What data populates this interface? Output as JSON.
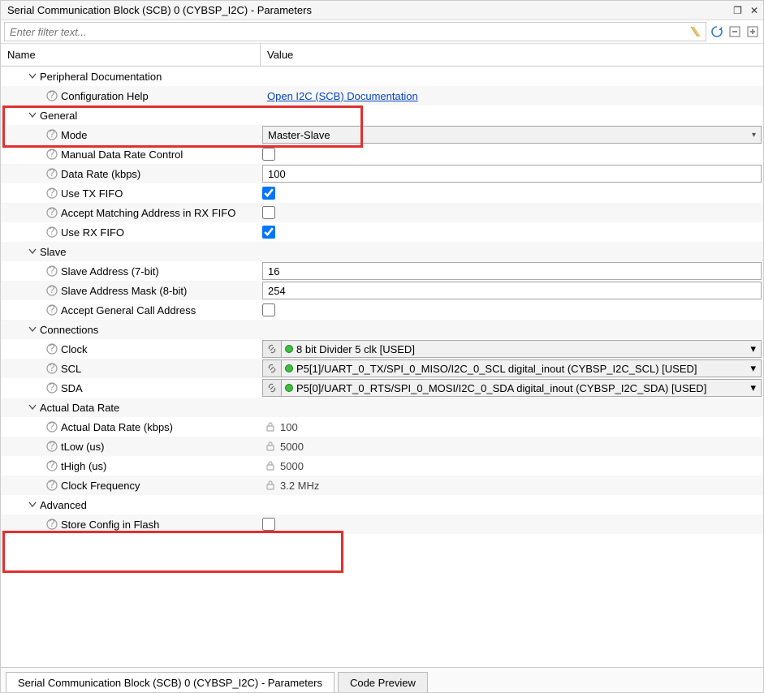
{
  "title": "Serial Communication Block (SCB) 0 (CYBSP_I2C) - Parameters",
  "filter": {
    "placeholder": "Enter filter text..."
  },
  "columns": {
    "name": "Name",
    "value": "Value"
  },
  "sections": {
    "docs": {
      "label": "Peripheral Documentation",
      "config_help": {
        "label": "Configuration Help",
        "value": "Open I2C (SCB) Documentation"
      }
    },
    "general": {
      "label": "General",
      "mode": {
        "label": "Mode",
        "value": "Master-Slave"
      },
      "manual_rate": {
        "label": "Manual Data Rate Control",
        "checked": false
      },
      "data_rate": {
        "label": "Data Rate (kbps)",
        "value": "100"
      },
      "use_tx_fifo": {
        "label": "Use TX FIFO",
        "checked": true
      },
      "accept_match": {
        "label": "Accept Matching Address in RX FIFO",
        "checked": false
      },
      "use_rx_fifo": {
        "label": "Use RX FIFO",
        "checked": true
      }
    },
    "slave": {
      "label": "Slave",
      "addr": {
        "label": "Slave Address (7-bit)",
        "value": "16"
      },
      "mask": {
        "label": "Slave Address Mask (8-bit)",
        "value": "254"
      },
      "general_call": {
        "label": "Accept General Call Address",
        "checked": false
      }
    },
    "connections": {
      "label": "Connections",
      "clock": {
        "label": "Clock",
        "value": "8 bit Divider 5 clk [USED]"
      },
      "scl": {
        "label": "SCL",
        "value": "P5[1]/UART_0_TX/SPI_0_MISO/I2C_0_SCL digital_inout (CYBSP_I2C_SCL) [USED]"
      },
      "sda": {
        "label": "SDA",
        "value": "P5[0]/UART_0_RTS/SPI_0_MOSI/I2C_0_SDA digital_inout (CYBSP_I2C_SDA) [USED]"
      }
    },
    "actual": {
      "label": "Actual Data Rate",
      "rate": {
        "label": "Actual Data Rate (kbps)",
        "value": "100"
      },
      "tlow": {
        "label": "tLow (us)",
        "value": "5000"
      },
      "thigh": {
        "label": "tHigh (us)",
        "value": "5000"
      },
      "clkfrq": {
        "label": "Clock Frequency",
        "value": "3.2 MHz"
      }
    },
    "advanced": {
      "label": "Advanced",
      "store_flash": {
        "label": "Store Config in Flash",
        "checked": false
      }
    }
  },
  "tabs": {
    "params": "Serial Communication Block (SCB) 0 (CYBSP_I2C) - Parameters",
    "code": "Code Preview"
  }
}
